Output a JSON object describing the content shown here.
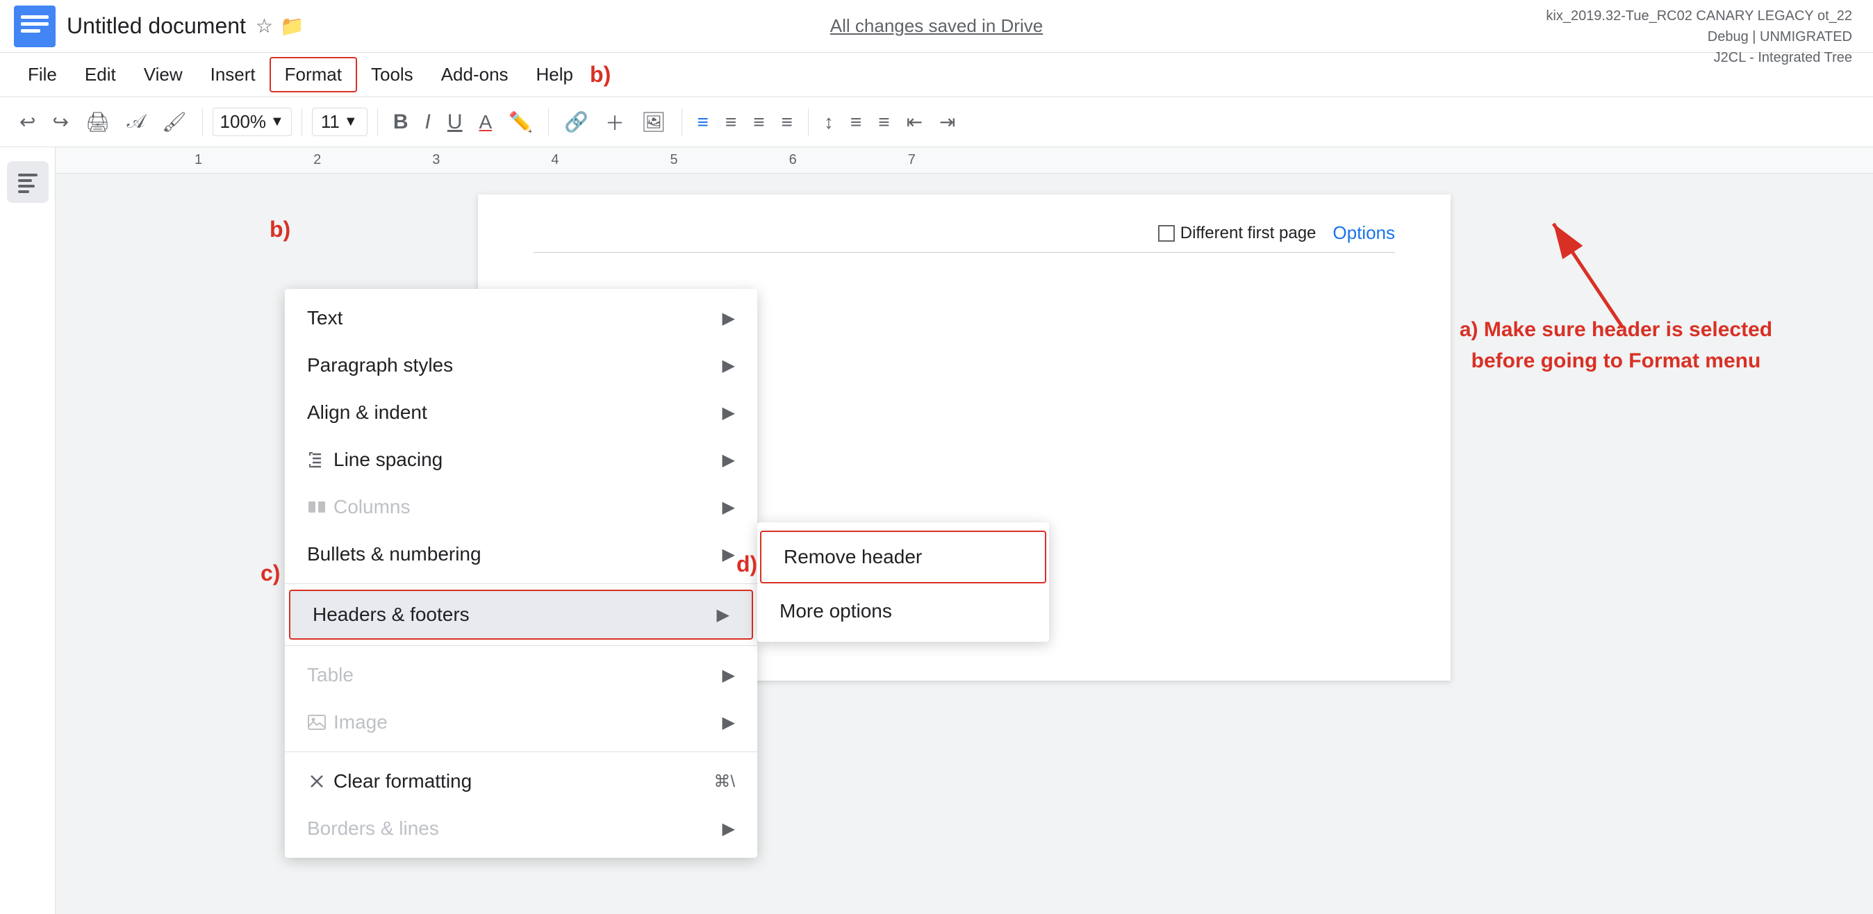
{
  "app": {
    "title": "Untitled document",
    "icon_color": "#4285f4",
    "version_info": "kix_2019.32-Tue_RC02 CANARY LEGACY ot_22\nDebug | UNMIGRATED\nJ2CL - Integrated Tree"
  },
  "save_status": "All changes saved in Drive",
  "menu": {
    "items": [
      "File",
      "Edit",
      "View",
      "Insert",
      "Format",
      "Tools",
      "Add-ons",
      "Help"
    ],
    "active": "Format"
  },
  "toolbar": {
    "zoom": "100%",
    "font_size": "11"
  },
  "format_menu": {
    "items": [
      {
        "label": "Text",
        "has_arrow": true,
        "disabled": false,
        "icon": ""
      },
      {
        "label": "Paragraph styles",
        "has_arrow": true,
        "disabled": false,
        "icon": ""
      },
      {
        "label": "Align & indent",
        "has_arrow": true,
        "disabled": false,
        "icon": ""
      },
      {
        "label": "Line spacing",
        "has_arrow": true,
        "disabled": false,
        "icon": "line-spacing"
      },
      {
        "label": "Columns",
        "has_arrow": true,
        "disabled": true,
        "icon": "columns"
      },
      {
        "label": "Bullets & numbering",
        "has_arrow": true,
        "disabled": false,
        "icon": ""
      },
      {
        "label": "Headers & footers",
        "has_arrow": true,
        "disabled": false,
        "highlighted": true
      },
      {
        "label": "Table",
        "has_arrow": true,
        "disabled": true,
        "icon": ""
      },
      {
        "label": "Image",
        "has_arrow": true,
        "disabled": true,
        "icon": "image"
      },
      {
        "label": "Clear formatting",
        "shortcut": "⌘\\",
        "has_arrow": false,
        "disabled": false,
        "icon": "clear"
      },
      {
        "label": "Borders & lines",
        "has_arrow": true,
        "disabled": true,
        "icon": ""
      }
    ]
  },
  "headers_submenu": {
    "items": [
      {
        "label": "Remove header",
        "highlighted": true
      },
      {
        "label": "More options",
        "highlighted": false
      }
    ]
  },
  "header_options": {
    "checkbox_label": "Different first page",
    "options_link": "Options"
  },
  "annotations": {
    "label_b": "b)",
    "label_c": "c)",
    "label_d": "d)",
    "annotation_text": "a) Make sure header is selected\nbefore going to Format menu"
  }
}
